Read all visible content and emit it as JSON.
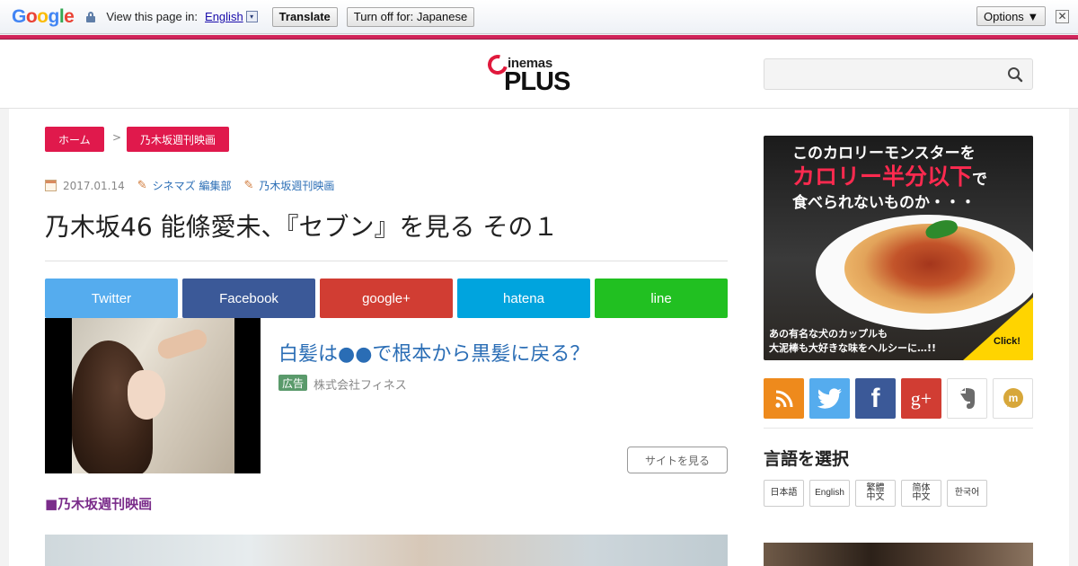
{
  "translate_bar": {
    "logo": "Google",
    "view_text": "View this page in:",
    "language": "English",
    "selector_glyph": "▾",
    "translate_label": "Translate",
    "turn_off_label": "Turn off for: Japanese",
    "options_label": "Options ▼",
    "close_glyph": "✕"
  },
  "header": {
    "logo_top": "inemas",
    "logo_bottom": "PLUS",
    "search_placeholder": ""
  },
  "breadcrumb": {
    "home": "ホーム",
    "separator": ">",
    "category": "乃木坂週刊映画"
  },
  "article": {
    "date": "2017.01.14",
    "author": "シネマズ 編集部",
    "category": "乃木坂週刊映画",
    "title": "乃木坂46 能條愛未、『セブン』を見る その１",
    "section_heading": "■乃木坂週刊映画"
  },
  "share": {
    "twitter": "Twitter",
    "facebook": "Facebook",
    "google": "google+",
    "hatena": "hatena",
    "line": "line"
  },
  "ad": {
    "title": "白髪は●●で根本から黒髪に戻る？",
    "badge": "広告",
    "sponsor": "株式会社フィネス",
    "visit_label": "サイトを見る"
  },
  "banner": {
    "line1": "このカロリーモンスターを",
    "line2": "カロリー半分以下",
    "line2_suffix": "で",
    "line3": "食べられないものか・・・",
    "line4": "あの有名な犬のカップルも",
    "line5": "大泥棒も大好きな味をヘルシーに…!!",
    "click": "Click!"
  },
  "social": {
    "facebook_glyph": "f",
    "google_glyph": "g+"
  },
  "language_select": {
    "title": "言語を選択",
    "options": [
      "日本語",
      "English",
      "繁體中文",
      "简体中文",
      "한국어"
    ]
  },
  "colors": {
    "accent": "#e0194c",
    "link": "#2a6db5",
    "section": "#7a2c8a"
  }
}
